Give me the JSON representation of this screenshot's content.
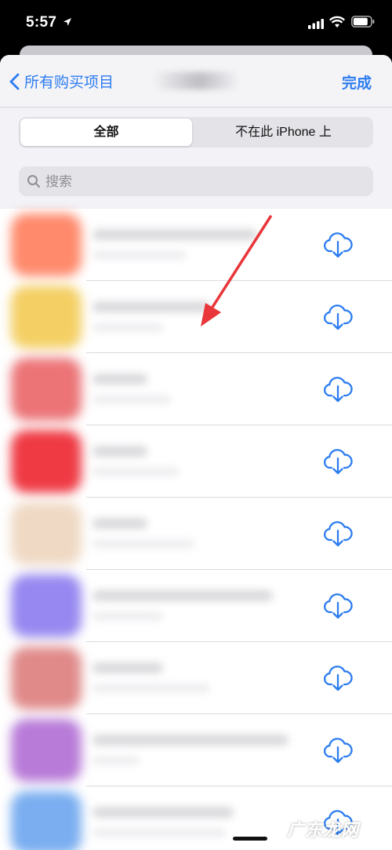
{
  "status_bar": {
    "time": "5:57"
  },
  "nav": {
    "back_label": "所有购买项目",
    "done_label": "完成"
  },
  "segmented": {
    "all_label": "全部",
    "not_on_device_label": "不在此 iPhone 上",
    "selected": "全部"
  },
  "search": {
    "placeholder": "搜索",
    "value": ""
  },
  "apps": [
    {
      "icon_color": "#ff8a6c",
      "action_icon": "cloud-download-icon"
    },
    {
      "icon_color": "#f4cf64",
      "action_icon": "cloud-download-icon"
    },
    {
      "icon_color": "#ec7477",
      "action_icon": "cloud-download-icon"
    },
    {
      "icon_color": "#ef3a44",
      "action_icon": "cloud-download-icon"
    },
    {
      "icon_color": "#efd9c4",
      "action_icon": "cloud-download-icon"
    },
    {
      "icon_color": "#9688f0",
      "action_icon": "cloud-download-icon"
    },
    {
      "icon_color": "#e08a8a",
      "action_icon": "cloud-download-icon"
    },
    {
      "icon_color": "#b87bd8",
      "action_icon": "cloud-download-icon"
    },
    {
      "icon_color": "#7aaef0",
      "action_icon": "cloud-download-icon"
    }
  ],
  "watermark": "广东龙网",
  "colors": {
    "accent": "#2c7cf0",
    "annotation_arrow": "#e8363a"
  }
}
